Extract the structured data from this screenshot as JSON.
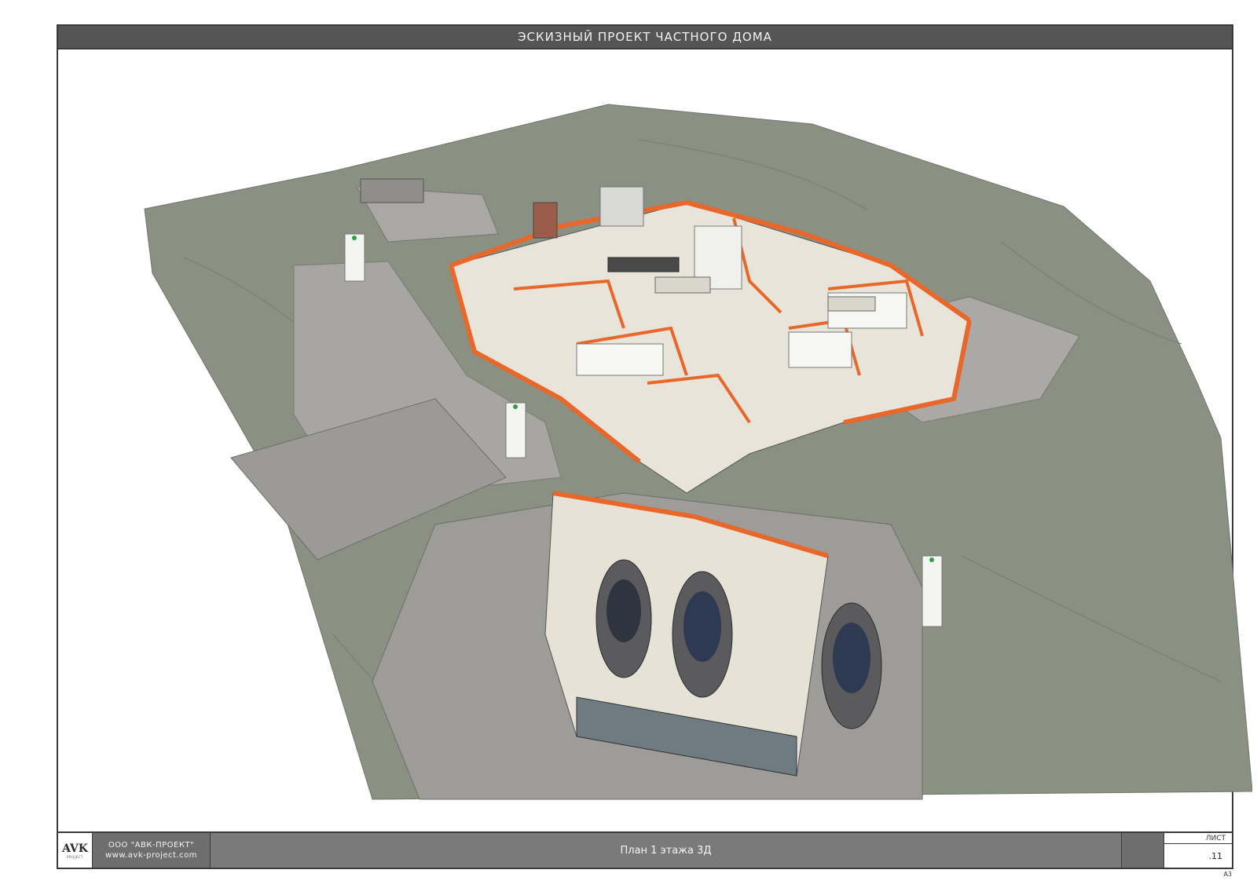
{
  "sheet": {
    "title": "ЭСКИЗНЫЙ ПРОЕКТ ЧАСТНОГО ДОМА",
    "paper_format": "А3"
  },
  "title_block": {
    "logo_text": "AVK",
    "logo_subtext": "PROJECT",
    "company_name": "ООО \"АВК-ПРОЕКТ\"",
    "company_site": "www.avk-project.com",
    "sheet_name": "План 1 этажа 3Д",
    "sheet_label": "ЛИСТ",
    "sheet_number": ".11"
  },
  "colors": {
    "grass": "#8a9183",
    "paving": "#a7a6a2",
    "wall_orange": "#e8672a",
    "floor": "#e8e4d9"
  }
}
